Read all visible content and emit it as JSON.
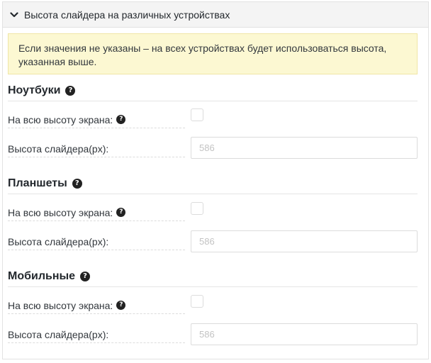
{
  "panel": {
    "title": "Высота слайдера на различных устройствах"
  },
  "notice": {
    "text": "Если значения не указаны – на всех устройствах будет использоваться высота, указанная выше."
  },
  "sections": [
    {
      "title": "Ноутбуки",
      "fullscreen_label": "На всю высоту экрана:",
      "fullscreen_checked": false,
      "height_label": "Высота слайдера(px):",
      "height_placeholder": "586"
    },
    {
      "title": "Планшеты",
      "fullscreen_label": "На всю высоту экрана:",
      "fullscreen_checked": false,
      "height_label": "Высота слайдера(px):",
      "height_placeholder": "586"
    },
    {
      "title": "Мобильные",
      "fullscreen_label": "На всю высоту экрана:",
      "fullscreen_checked": false,
      "height_label": "Высота слайдера(px):",
      "height_placeholder": "586"
    }
  ],
  "icons": {
    "collapse": "chevron-down-icon",
    "help": "question-circle-icon"
  }
}
